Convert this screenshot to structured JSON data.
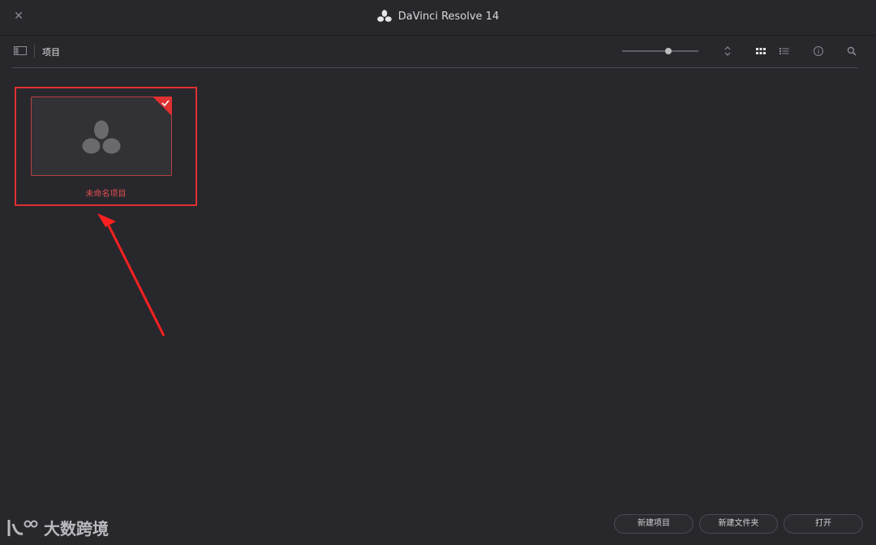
{
  "window": {
    "title": "DaVinci Resolve 14"
  },
  "toolbar": {
    "section_label": "项目"
  },
  "projects": [
    {
      "name": "未命名项目",
      "selected": true
    }
  ],
  "footer": {
    "new_project": "新建项目",
    "new_folder": "新建文件夹",
    "open": "打开"
  },
  "watermark": {
    "text": "大数跨境"
  },
  "colors": {
    "background": "#28272c",
    "selection_red": "#e03030",
    "label_red": "#e05050"
  },
  "icons": {
    "close": "close-icon",
    "app_logo": "davinci-logo-icon",
    "panel": "panel-toggle-icon",
    "sort": "sort-icon",
    "grid_view": "grid-view-icon",
    "list_view": "list-view-icon",
    "info": "info-icon",
    "search": "search-icon"
  }
}
